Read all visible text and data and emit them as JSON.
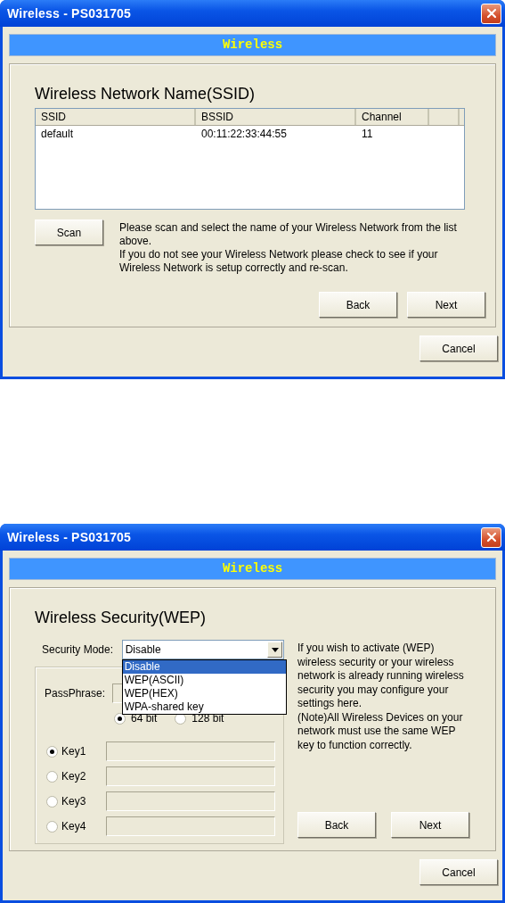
{
  "dialogs": [
    {
      "kind": "ssid",
      "title": "Wireless - PS031705",
      "banner": "Wireless",
      "heading": "Wireless Network Name(SSID)",
      "table": {
        "columns": [
          "SSID",
          "BSSID",
          "Channel"
        ],
        "rows": [
          [
            "default",
            "00:11:22:33:44:55",
            "11"
          ]
        ]
      },
      "scan_button": "Scan",
      "help_text": [
        "Please scan and select the name of your Wireless Network from the list above.",
        "If you do not see your Wireless Network please check to see if your Wireless Network is setup correctly and re-scan."
      ],
      "buttons": [
        "Back",
        "Next"
      ],
      "cancel": "Cancel"
    },
    {
      "kind": "wep",
      "title": "Wireless - PS031705",
      "banner": "Wireless",
      "heading": "Wireless Security(WEP)",
      "security_mode": {
        "label": "Security Mode:",
        "value": "Disable",
        "expanded": true,
        "options": [
          {
            "label": "Disable",
            "selected": true
          },
          {
            "label": "WEP(ASCII)",
            "selected": false
          },
          {
            "label": "WEP(HEX)",
            "selected": false
          },
          {
            "label": "WPA-shared key",
            "selected": false
          }
        ]
      },
      "passphrase": {
        "label": "PassPhrase:"
      },
      "key_lengths": [
        {
          "label": "64 bit",
          "selected": true
        },
        {
          "label": "128 bit",
          "selected": false
        }
      ],
      "keys": [
        {
          "label": "Key1",
          "selected": true
        },
        {
          "label": "Key2",
          "selected": false
        },
        {
          "label": "Key3",
          "selected": false
        },
        {
          "label": "Key4",
          "selected": false
        }
      ],
      "help_text": [
        "If you wish to activate (WEP) wireless security or your wireless network is already running wireless security you may configure your settings here.",
        "(Note)All Wireless Devices on your network must use the same WEP key to function correctly."
      ],
      "buttons": [
        "Back",
        "Next"
      ],
      "cancel": "Cancel"
    }
  ]
}
